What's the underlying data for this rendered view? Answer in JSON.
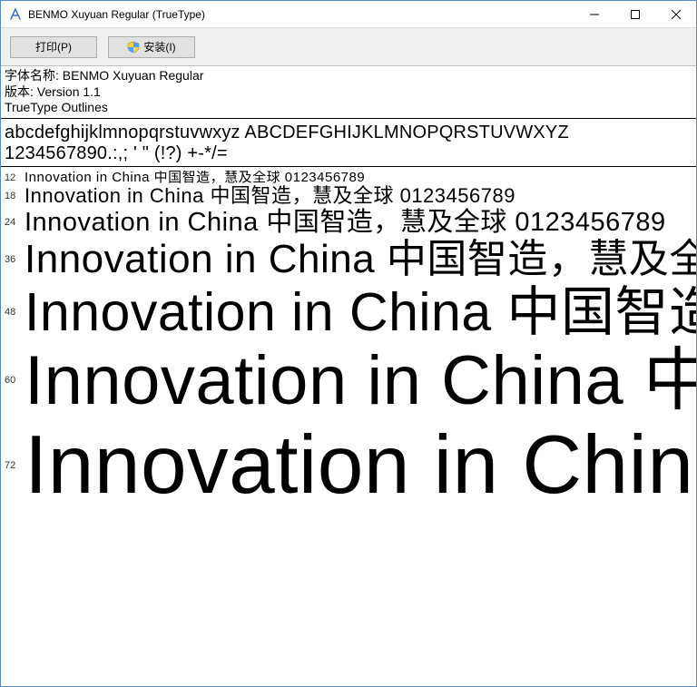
{
  "titlebar": {
    "title": "BENMO Xuyuan Regular (TrueType)"
  },
  "toolbar": {
    "print_label": "打印(P)",
    "install_label": "安装(I)"
  },
  "meta": {
    "name_line": "字体名称: BENMO Xuyuan Regular",
    "version_line": "版本: Version 1.1",
    "outlines_line": "TrueType Outlines"
  },
  "charset": {
    "line1": "abcdefghijklmnopqrstuvwxyz ABCDEFGHIJKLMNOPQRSTUVWXYZ",
    "line2": "1234567890.:,; ' \" (!?) +-*/="
  },
  "sample_text": "Innovation in China 中国智造，慧及全球 0123456789",
  "sizes": {
    "s12": "12",
    "s18": "18",
    "s24": "24",
    "s36": "36",
    "s48": "48",
    "s60": "60",
    "s72": "72"
  }
}
